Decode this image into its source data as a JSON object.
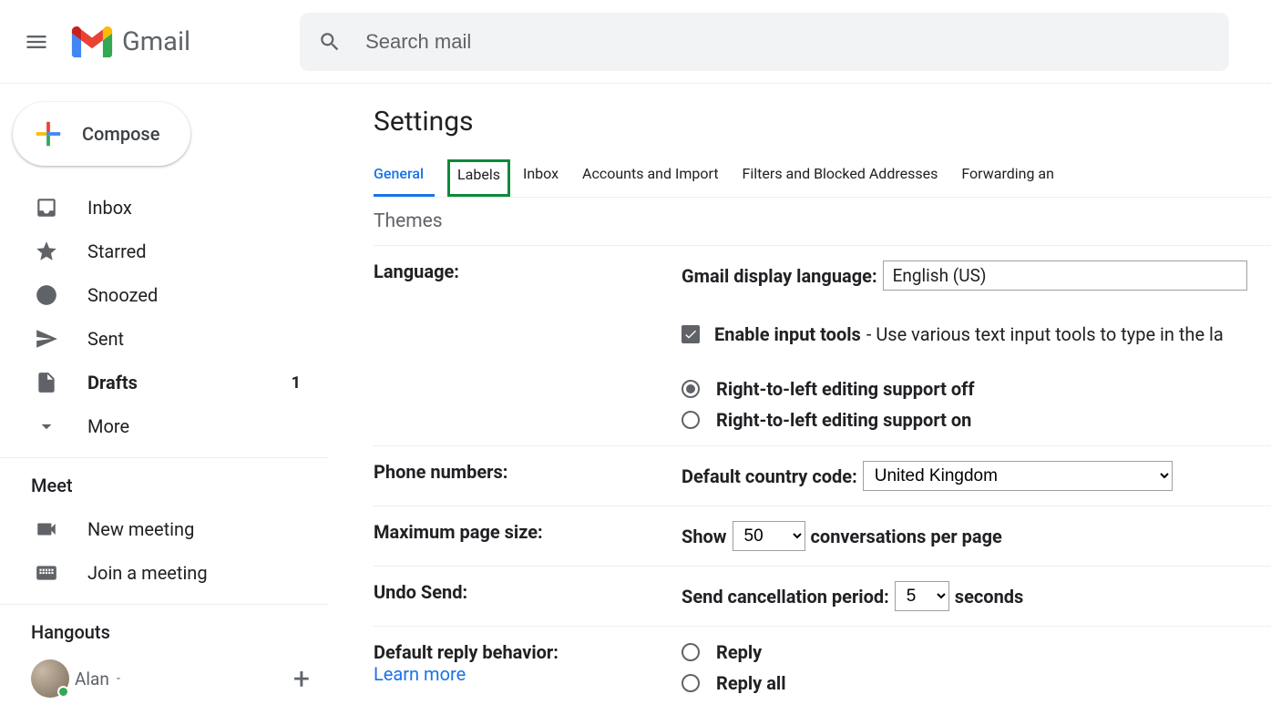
{
  "header": {
    "product": "Gmail",
    "search_placeholder": "Search mail"
  },
  "compose_label": "Compose",
  "sidebar": {
    "items": [
      {
        "label": "Inbox"
      },
      {
        "label": "Starred"
      },
      {
        "label": "Snoozed"
      },
      {
        "label": "Sent"
      },
      {
        "label": "Drafts",
        "count": "1"
      },
      {
        "label": "More"
      }
    ]
  },
  "meet": {
    "title": "Meet",
    "new_meeting": "New meeting",
    "join_meeting": "Join a meeting"
  },
  "hangouts": {
    "title": "Hangouts",
    "user": "Alan"
  },
  "settings": {
    "title": "Settings",
    "tabs": [
      "General",
      "Labels",
      "Inbox",
      "Accounts and Import",
      "Filters and Blocked Addresses",
      "Forwarding an"
    ],
    "tabs_row2": "Themes",
    "rows": {
      "language": {
        "label": "Language:",
        "display_label": "Gmail display language:",
        "display_value": "English (US)",
        "enable_input_tools": "Enable input tools",
        "enable_input_tools_desc": " - Use various text input tools to type in the la",
        "rtl_off": "Right-to-left editing support off",
        "rtl_on": "Right-to-left editing support on"
      },
      "phone": {
        "label": "Phone numbers:",
        "cc_label": "Default country code:",
        "cc_value": "United Kingdom"
      },
      "page_size": {
        "label": "Maximum page size:",
        "show": "Show",
        "value": "50",
        "suffix": "conversations per page"
      },
      "undo": {
        "label": "Undo Send:",
        "period_label": "Send cancellation period:",
        "value": "5",
        "suffix": "seconds"
      },
      "reply": {
        "label": "Default reply behavior:",
        "learn_more": "Learn more",
        "reply": "Reply",
        "reply_all": "Reply all"
      }
    }
  }
}
